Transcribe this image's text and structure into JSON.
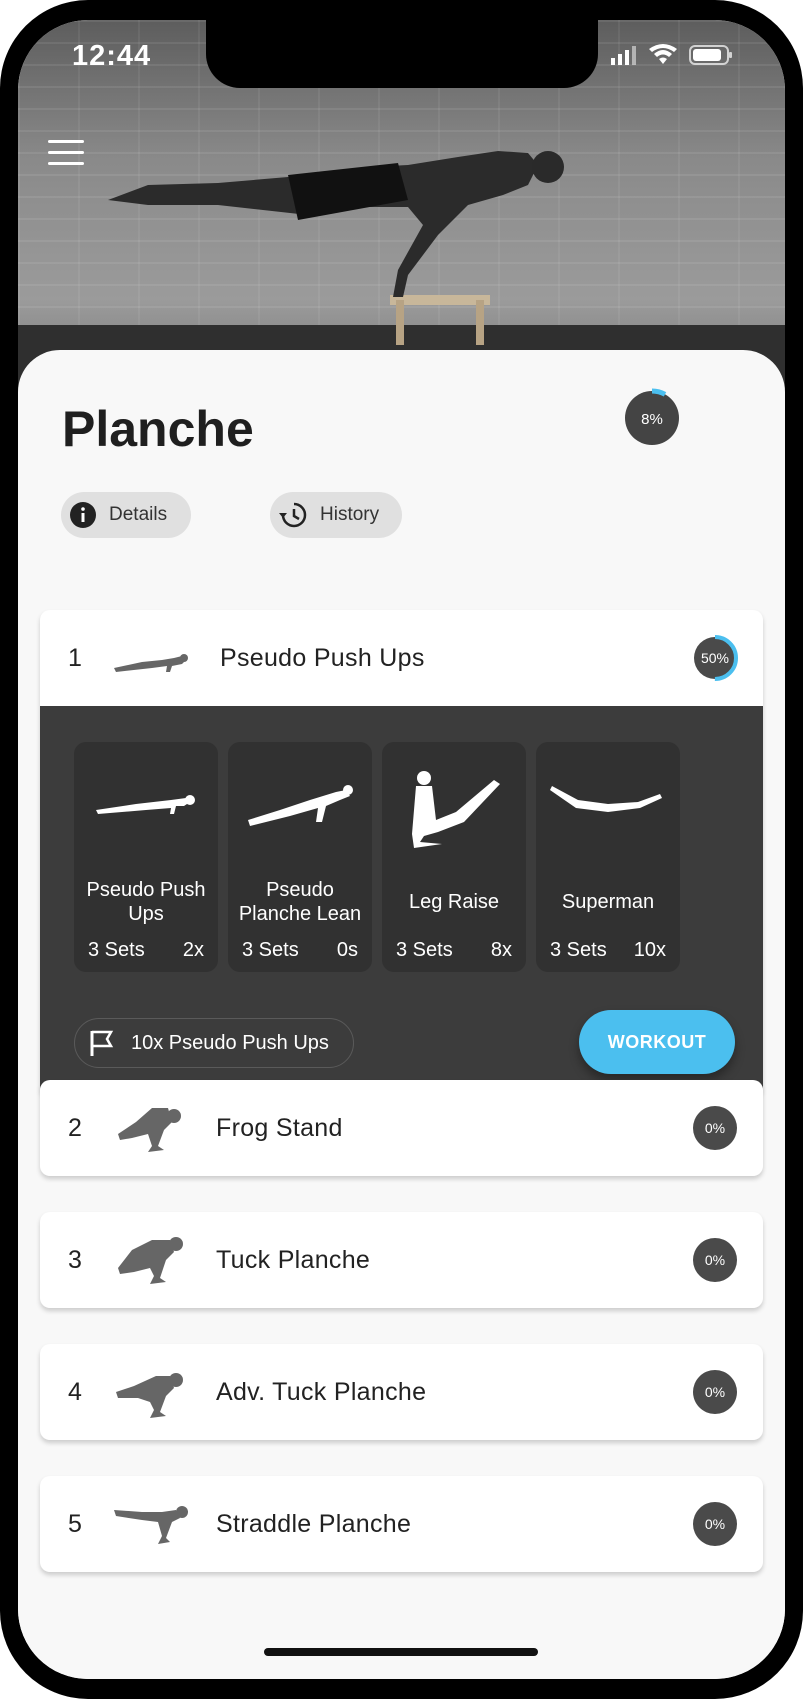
{
  "status_bar": {
    "time": "12:44"
  },
  "header": {
    "title": "Planche",
    "overall_progress": "8%",
    "overall_progress_value": 8
  },
  "chips": {
    "details": "Details",
    "history": "History"
  },
  "steps": [
    {
      "number": "1",
      "name": "Pseudo Push Ups",
      "progress": "50%",
      "progress_value": 50
    },
    {
      "number": "2",
      "name": "Frog Stand",
      "progress": "0%",
      "progress_value": 0
    },
    {
      "number": "3",
      "name": "Tuck Planche",
      "progress": "0%",
      "progress_value": 0
    },
    {
      "number": "4",
      "name": "Adv. Tuck Planche",
      "progress": "0%",
      "progress_value": 0
    },
    {
      "number": "5",
      "name": "Straddle Planche",
      "progress": "0%",
      "progress_value": 0
    }
  ],
  "exercises": [
    {
      "name": "Pseudo Push Ups",
      "sets": "3 Sets",
      "reps": "2x"
    },
    {
      "name": "Pseudo Planche Lean",
      "sets": "3 Sets",
      "reps": "0s"
    },
    {
      "name": "Leg Raise",
      "sets": "3 Sets",
      "reps": "8x"
    },
    {
      "name": "Superman",
      "sets": "3 Sets",
      "reps": "10x"
    }
  ],
  "goal": {
    "label": "10x Pseudo Push Ups",
    "icon": "flag-icon"
  },
  "workout_button": {
    "label": "WORKOUT"
  },
  "colors": {
    "accent": "#4bbfef",
    "dark_panel": "#3c3c3c",
    "tile": "#313131",
    "badge": "#444444"
  }
}
